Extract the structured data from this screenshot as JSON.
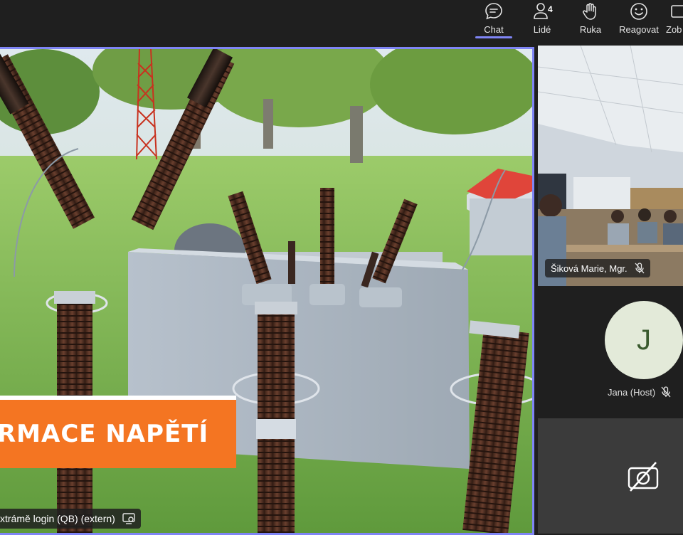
{
  "toolbar": {
    "chat": "Chat",
    "people": "Lidé",
    "people_count": "4",
    "hand": "Ruka",
    "react": "Reagovat",
    "view": "Zob"
  },
  "stage": {
    "banner": "RMACE NAPĚTÍ",
    "presenter": "xtrámě login (QB) (extern)"
  },
  "participants": [
    {
      "name": "Šiková Marie, Mgr."
    },
    {
      "name": "Jana (Host)",
      "initial": "J"
    }
  ],
  "colors": {
    "accent": "#7f85f5",
    "banner": "#f47522"
  }
}
